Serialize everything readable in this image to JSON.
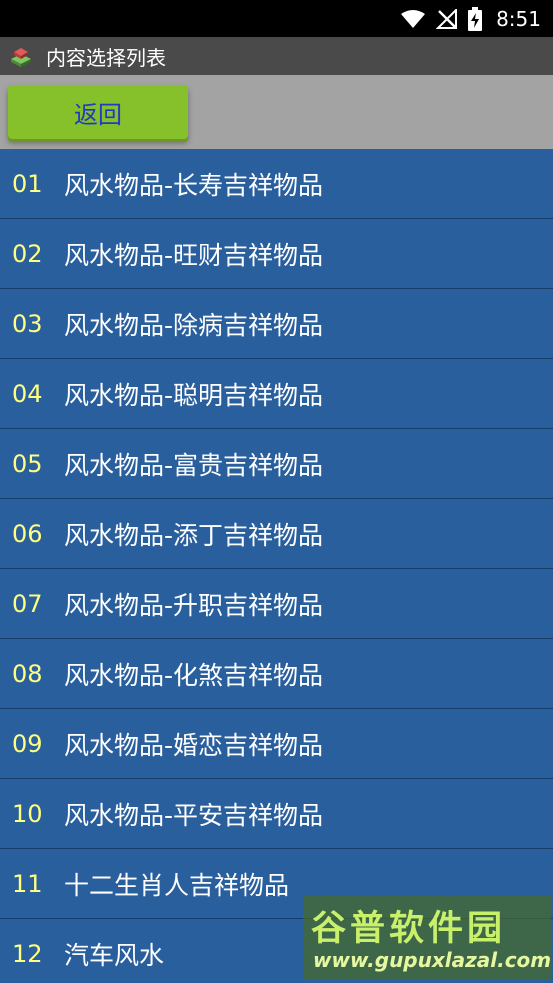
{
  "status_bar": {
    "time": "8:51"
  },
  "title_bar": {
    "title": "内容选择列表"
  },
  "toolbar": {
    "back_label": "返回"
  },
  "list": [
    {
      "num": "01",
      "text": "风水物品-长寿吉祥物品"
    },
    {
      "num": "02",
      "text": "风水物品-旺财吉祥物品"
    },
    {
      "num": "03",
      "text": "风水物品-除病吉祥物品"
    },
    {
      "num": "04",
      "text": "风水物品-聪明吉祥物品"
    },
    {
      "num": "05",
      "text": "风水物品-富贵吉祥物品"
    },
    {
      "num": "06",
      "text": "风水物品-添丁吉祥物品"
    },
    {
      "num": "07",
      "text": "风水物品-升职吉祥物品"
    },
    {
      "num": "08",
      "text": "风水物品-化煞吉祥物品"
    },
    {
      "num": "09",
      "text": "风水物品-婚恋吉祥物品"
    },
    {
      "num": "10",
      "text": "风水物品-平安吉祥物品"
    },
    {
      "num": "11",
      "text": "十二生肖人吉祥物品"
    },
    {
      "num": "12",
      "text": "汽车风水"
    }
  ],
  "watermark": {
    "title": "谷普软件园",
    "url": "www.gupuxlazal.com"
  }
}
